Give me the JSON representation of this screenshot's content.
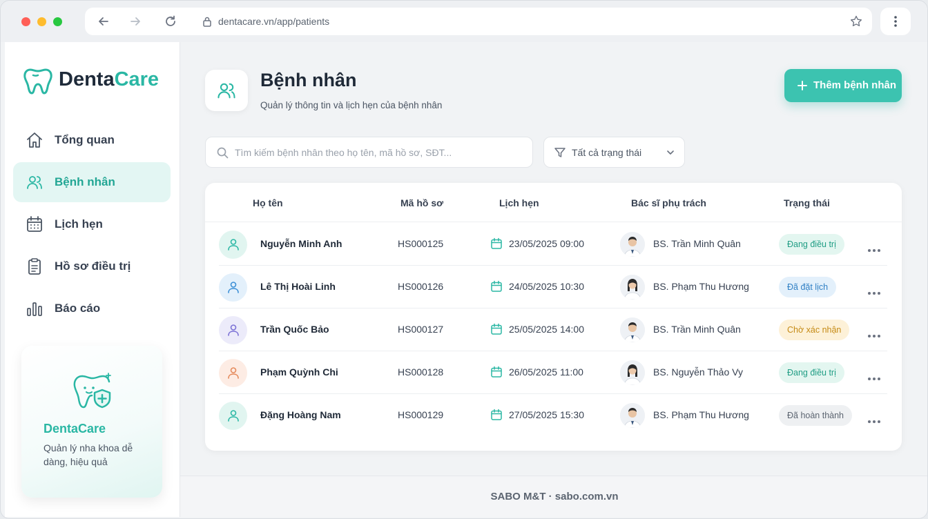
{
  "browser": {
    "url": "dentacare.vn/app/patients"
  },
  "brand": {
    "part1": "Denta",
    "part2": "Care",
    "accent_color": "#2ab7a4"
  },
  "sidebar": {
    "items": [
      {
        "label": "Tổng quan",
        "icon": "home-icon",
        "active": false
      },
      {
        "label": "Bệnh nhân",
        "icon": "users-icon",
        "active": true
      },
      {
        "label": "Lịch hẹn",
        "icon": "calendar-icon",
        "active": false
      },
      {
        "label": "Hồ sơ điều trị",
        "icon": "clipboard-icon",
        "active": false
      },
      {
        "label": "Báo cáo",
        "icon": "bar-chart-icon",
        "active": false
      }
    ],
    "promo": {
      "title": "DentaCare",
      "description": "Quản lý nha khoa dễ dàng, hiệu quả"
    }
  },
  "header": {
    "title": "Bệnh nhân",
    "subtitle": "Quản lý thông tin và lịch hẹn của bệnh nhân",
    "add_button": "Thêm bệnh nhân"
  },
  "search": {
    "placeholder": "Tìm kiếm bệnh nhân theo họ tên, mã hồ sơ, SĐT..."
  },
  "filter": {
    "label": "Tất cả trạng thái"
  },
  "table": {
    "columns": [
      "Họ tên",
      "Mã hồ sơ",
      "Lịch hẹn",
      "Bác sĩ phụ trách",
      "Trạng thái"
    ],
    "rows": [
      {
        "name": "Nguyễn Minh Anh",
        "code": "HS000125",
        "appointment": "23/05/2025 09:00",
        "doctor": "BS. Trần Minh Quân",
        "status": "Đang điều trị"
      },
      {
        "name": "Lê Thị Hoài Linh",
        "code": "HS000126",
        "appointment": "24/05/2025 10:30",
        "doctor": "BS. Phạm Thu Hương",
        "status": "Đã đặt lịch"
      },
      {
        "name": "Trần Quốc Bảo",
        "code": "HS000127",
        "appointment": "25/05/2025 14:00",
        "doctor": "BS. Trần Minh Quân",
        "status": "Chờ xác nhận"
      },
      {
        "name": "Phạm Quỳnh Chi",
        "code": "HS000128",
        "appointment": "26/05/2025 11:00",
        "doctor": "BS. Nguyễn Thảo Vy",
        "status": "Đang điều trị"
      },
      {
        "name": "Đặng Hoàng Nam",
        "code": "HS000129",
        "appointment": "27/05/2025 15:30",
        "doctor": "BS. Phạm Thu Hương",
        "status": "Đã hoàn thành"
      }
    ]
  },
  "footer": {
    "text": "SABO M&T · sabo.com.vn"
  }
}
